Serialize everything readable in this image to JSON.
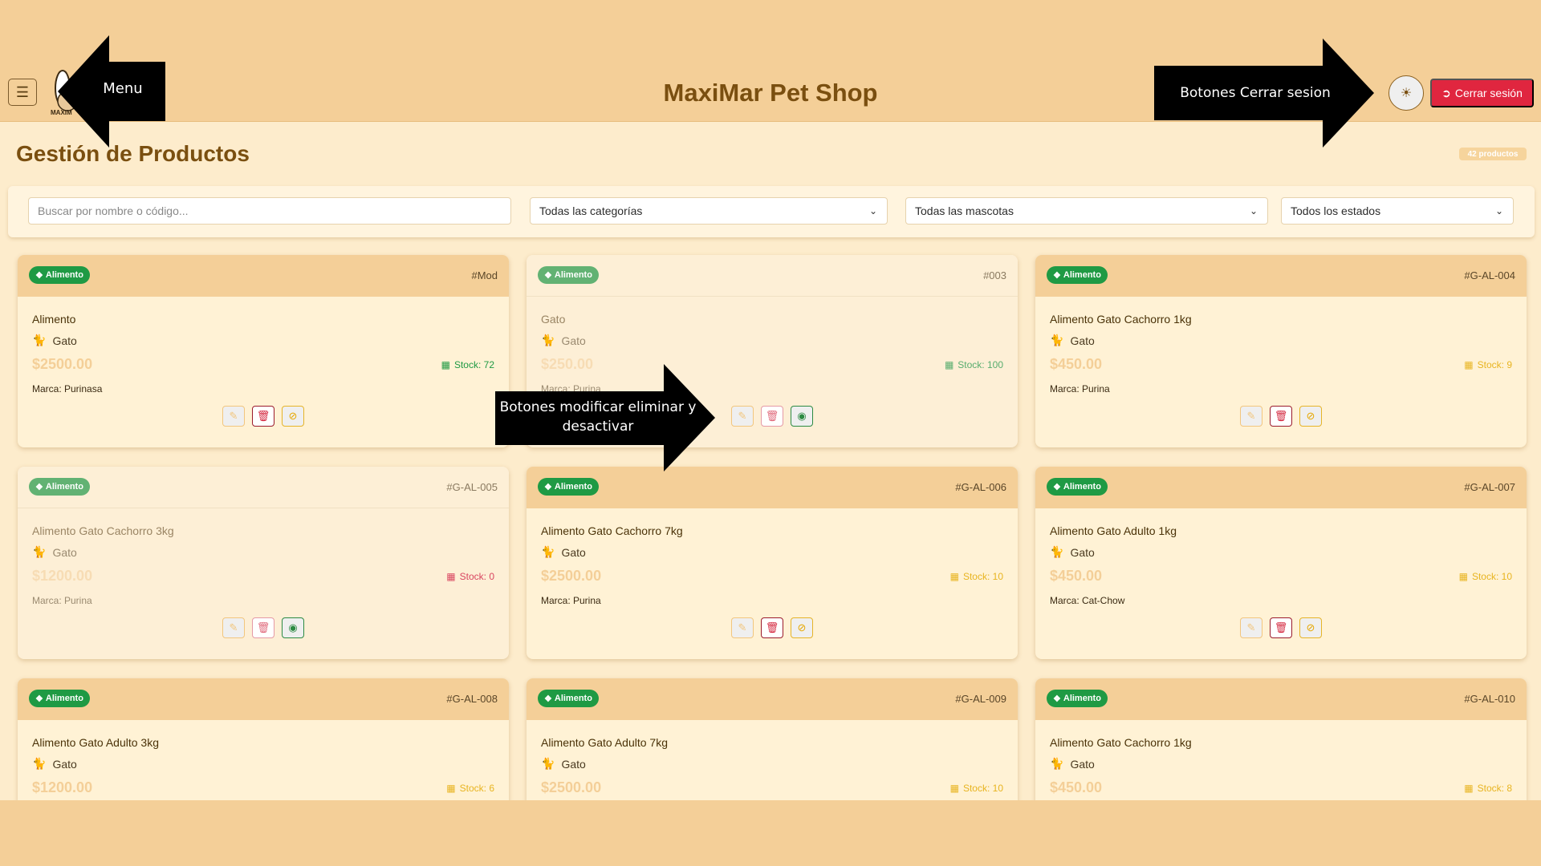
{
  "header": {
    "title": "MaxiMar Pet Shop",
    "logo_text": "MAXIM",
    "menu_icon": "hamburger-icon",
    "theme_icon": "sun-icon",
    "logout_label": "Cerrar sesión"
  },
  "page": {
    "title": "Gestión de Productos",
    "count_label": "42 productos"
  },
  "filters": {
    "search_placeholder": "Buscar por nombre o código...",
    "category": "Todas las categorías",
    "pet": "Todas las mascotas",
    "status": "Todos los estados"
  },
  "products": [
    {
      "category": "Alimento",
      "code": "#Mod",
      "name": "Alimento",
      "pet": "Gato",
      "price": "$2500.00",
      "stock": "Stock: 72",
      "stock_level": "ok",
      "brand": "Marca: Purinasa",
      "active": true
    },
    {
      "category": "Alimento",
      "code": "#003",
      "name": "Gato",
      "pet": "Gato",
      "price": "$250.00",
      "stock": "Stock: 100",
      "stock_level": "ok",
      "brand": "Marca: Purina",
      "active": false
    },
    {
      "category": "Alimento",
      "code": "#G-AL-004",
      "name": "Alimento Gato Cachorro 1kg",
      "pet": "Gato",
      "price": "$450.00",
      "stock": "Stock: 9",
      "stock_level": "low",
      "brand": "Marca: Purina",
      "active": true
    },
    {
      "category": "Alimento",
      "code": "#G-AL-005",
      "name": "Alimento Gato Cachorro 3kg",
      "pet": "Gato",
      "price": "$1200.00",
      "stock": "Stock: 0",
      "stock_level": "out",
      "brand": "Marca: Purina",
      "active": false
    },
    {
      "category": "Alimento",
      "code": "#G-AL-006",
      "name": "Alimento Gato Cachorro 7kg",
      "pet": "Gato",
      "price": "$2500.00",
      "stock": "Stock: 10",
      "stock_level": "low",
      "brand": "Marca: Purina",
      "active": true
    },
    {
      "category": "Alimento",
      "code": "#G-AL-007",
      "name": "Alimento Gato Adulto 1kg",
      "pet": "Gato",
      "price": "$450.00",
      "stock": "Stock: 10",
      "stock_level": "low",
      "brand": "Marca: Cat-Chow",
      "active": true
    },
    {
      "category": "Alimento",
      "code": "#G-AL-008",
      "name": "Alimento Gato Adulto 3kg",
      "pet": "Gato",
      "price": "$1200.00",
      "stock": "Stock: 6",
      "stock_level": "low",
      "brand": "",
      "active": true
    },
    {
      "category": "Alimento",
      "code": "#G-AL-009",
      "name": "Alimento Gato Adulto 7kg",
      "pet": "Gato",
      "price": "$2500.00",
      "stock": "Stock: 10",
      "stock_level": "low",
      "brand": "",
      "active": true
    },
    {
      "category": "Alimento",
      "code": "#G-AL-010",
      "name": "Alimento Gato Cachorro 1kg",
      "pet": "Gato",
      "price": "$450.00",
      "stock": "Stock: 8",
      "stock_level": "low",
      "brand": "",
      "active": true
    }
  ],
  "annotations": {
    "menu": "Menu",
    "logout": "Botones Cerrar sesion",
    "actions_line1": "Botones modificar eliminar y",
    "actions_line2": "desactivar"
  },
  "colors": {
    "background": "#f4cf98",
    "accent": "#7a4f10",
    "danger": "#e0263f",
    "success": "#1f9a44",
    "warning": "#e8b420"
  }
}
